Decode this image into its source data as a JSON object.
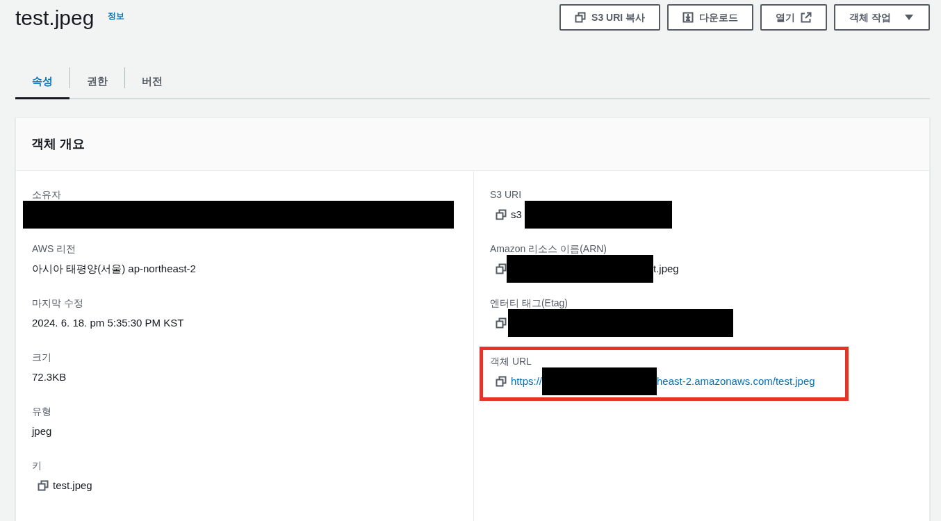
{
  "header": {
    "title": "test.jpeg",
    "info_link": "정보"
  },
  "actions": [
    {
      "label": "S3 URI 복사",
      "kind": "copy"
    },
    {
      "label": "다운로드",
      "kind": "download"
    },
    {
      "label": "열기",
      "kind": "external"
    },
    {
      "label": "객체 작업",
      "kind": "dropdown"
    }
  ],
  "tabs": [
    {
      "label": "속성",
      "selected": true
    },
    {
      "label": "권한",
      "selected": false
    },
    {
      "label": "버전",
      "selected": false
    }
  ],
  "overview": {
    "title": "객체 개요",
    "left": [
      {
        "label": "소유자",
        "kind": "text",
        "redacted": true,
        "highlighted": false
      },
      {
        "label": "AWS 리전",
        "kind": "text",
        "value": "아시아 태평양(서울) ap-northeast-2",
        "redacted": false,
        "highlighted": false
      },
      {
        "label": "마지막 수정",
        "kind": "text",
        "value": "2024. 6. 18. pm 5:35:30 PM KST",
        "redacted": false,
        "highlighted": false
      },
      {
        "label": "크기",
        "kind": "text",
        "value": "72.3KB",
        "redacted": false,
        "highlighted": false
      },
      {
        "label": "유형",
        "kind": "text",
        "value": "jpeg",
        "redacted": false,
        "highlighted": false
      },
      {
        "label": "키",
        "kind": "copy",
        "value": "test.jpeg",
        "redacted": false,
        "highlighted": false
      }
    ],
    "right": [
      {
        "label": "S3 URI",
        "kind": "copy",
        "value": "s3",
        "redacted": true,
        "highlighted": false
      },
      {
        "label": "Amazon 리소스 이름(ARN)",
        "kind": "copy",
        "value_after": "t.jpeg",
        "redacted": true,
        "highlighted": false
      },
      {
        "label": "엔터티 태그(Etag)",
        "kind": "copy",
        "redacted": true,
        "highlighted": false
      },
      {
        "label": "객체 URL",
        "kind": "copy_link",
        "value": "https://",
        "value_after": "heast-2.amazonaws.com/test.jpeg",
        "redacted": true,
        "highlighted": true
      }
    ]
  }
}
